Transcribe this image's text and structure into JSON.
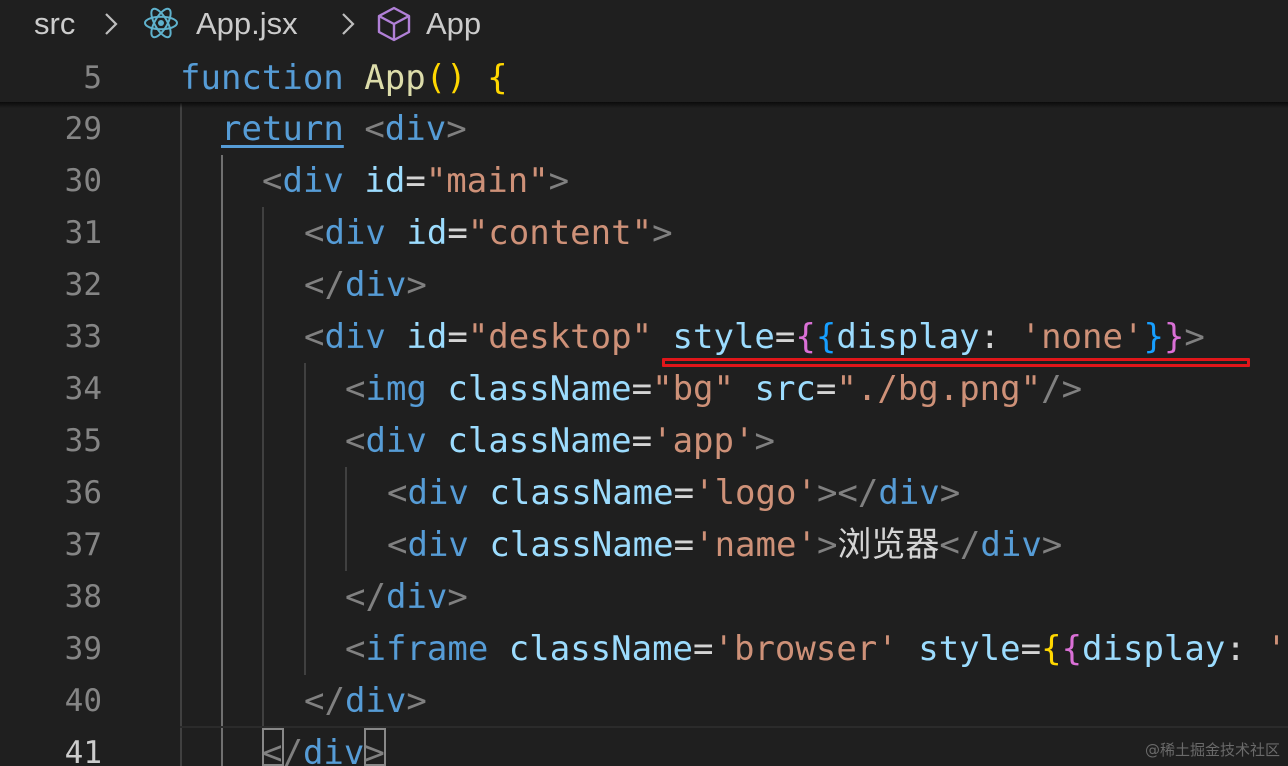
{
  "breadcrumb": {
    "folder": "src",
    "file": "App.jsx",
    "symbol": "App",
    "file_icon": "react-icon",
    "symbol_icon": "cube-icon"
  },
  "sticky_line": {
    "number": "5",
    "tokens": [
      {
        "t": "function",
        "c": "kw"
      },
      {
        "t": " ",
        "c": "txt"
      },
      {
        "t": "App",
        "c": "fn"
      },
      {
        "t": "()",
        "c": "br1"
      },
      {
        "t": " ",
        "c": "txt"
      },
      {
        "t": "{",
        "c": "br1"
      }
    ]
  },
  "lines": [
    {
      "number": "29",
      "tokens": [
        {
          "t": "return",
          "c": "ctrl"
        },
        {
          "t": " ",
          "c": "txt"
        },
        {
          "t": "<",
          "c": "tagb"
        },
        {
          "t": "div",
          "c": "tag"
        },
        {
          "t": ">",
          "c": "tagb"
        }
      ]
    },
    {
      "number": "30",
      "tokens": [
        {
          "t": "<",
          "c": "tagb"
        },
        {
          "t": "div",
          "c": "tag"
        },
        {
          "t": " ",
          "c": "txt"
        },
        {
          "t": "id",
          "c": "attr"
        },
        {
          "t": "=",
          "c": "txt"
        },
        {
          "t": "\"main\"",
          "c": "str"
        },
        {
          "t": ">",
          "c": "tagb"
        }
      ]
    },
    {
      "number": "31",
      "tokens": [
        {
          "t": "<",
          "c": "tagb"
        },
        {
          "t": "div",
          "c": "tag"
        },
        {
          "t": " ",
          "c": "txt"
        },
        {
          "t": "id",
          "c": "attr"
        },
        {
          "t": "=",
          "c": "txt"
        },
        {
          "t": "\"content\"",
          "c": "str"
        },
        {
          "t": ">",
          "c": "tagb"
        }
      ]
    },
    {
      "number": "32",
      "tokens": [
        {
          "t": "</",
          "c": "tagb"
        },
        {
          "t": "div",
          "c": "tag"
        },
        {
          "t": ">",
          "c": "tagb"
        }
      ]
    },
    {
      "number": "33",
      "tokens": [
        {
          "t": "<",
          "c": "tagb"
        },
        {
          "t": "div",
          "c": "tag"
        },
        {
          "t": " ",
          "c": "txt"
        },
        {
          "t": "id",
          "c": "attr"
        },
        {
          "t": "=",
          "c": "txt"
        },
        {
          "t": "\"desktop\"",
          "c": "str"
        },
        {
          "t": " ",
          "c": "txt"
        },
        {
          "t": "style",
          "c": "attr"
        },
        {
          "t": "=",
          "c": "txt"
        },
        {
          "t": "{",
          "c": "br2"
        },
        {
          "t": "{",
          "c": "br3"
        },
        {
          "t": "display",
          "c": "attr"
        },
        {
          "t": ": ",
          "c": "txt"
        },
        {
          "t": "'none'",
          "c": "str"
        },
        {
          "t": "}",
          "c": "br3"
        },
        {
          "t": "}",
          "c": "br2"
        },
        {
          "t": ">",
          "c": "tagb"
        }
      ]
    },
    {
      "number": "34",
      "tokens": [
        {
          "t": "<",
          "c": "tagb"
        },
        {
          "t": "img",
          "c": "tag"
        },
        {
          "t": " ",
          "c": "txt"
        },
        {
          "t": "className",
          "c": "attr"
        },
        {
          "t": "=",
          "c": "txt"
        },
        {
          "t": "\"bg\"",
          "c": "str"
        },
        {
          "t": " ",
          "c": "txt"
        },
        {
          "t": "src",
          "c": "attr"
        },
        {
          "t": "=",
          "c": "txt"
        },
        {
          "t": "\"./bg.png\"",
          "c": "str"
        },
        {
          "t": "/>",
          "c": "tagb"
        }
      ]
    },
    {
      "number": "35",
      "tokens": [
        {
          "t": "<",
          "c": "tagb"
        },
        {
          "t": "div",
          "c": "tag"
        },
        {
          "t": " ",
          "c": "txt"
        },
        {
          "t": "className",
          "c": "attr"
        },
        {
          "t": "=",
          "c": "txt"
        },
        {
          "t": "'app'",
          "c": "str"
        },
        {
          "t": ">",
          "c": "tagb"
        }
      ]
    },
    {
      "number": "36",
      "tokens": [
        {
          "t": "<",
          "c": "tagb"
        },
        {
          "t": "div",
          "c": "tag"
        },
        {
          "t": " ",
          "c": "txt"
        },
        {
          "t": "className",
          "c": "attr"
        },
        {
          "t": "=",
          "c": "txt"
        },
        {
          "t": "'logo'",
          "c": "str"
        },
        {
          "t": "></",
          "c": "tagb"
        },
        {
          "t": "div",
          "c": "tag"
        },
        {
          "t": ">",
          "c": "tagb"
        }
      ]
    },
    {
      "number": "37",
      "tokens": [
        {
          "t": "<",
          "c": "tagb"
        },
        {
          "t": "div",
          "c": "tag"
        },
        {
          "t": " ",
          "c": "txt"
        },
        {
          "t": "className",
          "c": "attr"
        },
        {
          "t": "=",
          "c": "txt"
        },
        {
          "t": "'name'",
          "c": "str"
        },
        {
          "t": ">",
          "c": "tagb"
        },
        {
          "t": "浏览器",
          "c": "txt"
        },
        {
          "t": "</",
          "c": "tagb"
        },
        {
          "t": "div",
          "c": "tag"
        },
        {
          "t": ">",
          "c": "tagb"
        }
      ]
    },
    {
      "number": "38",
      "tokens": [
        {
          "t": "</",
          "c": "tagb"
        },
        {
          "t": "div",
          "c": "tag"
        },
        {
          "t": ">",
          "c": "tagb"
        }
      ]
    },
    {
      "number": "39",
      "tokens": [
        {
          "t": "<",
          "c": "tagb"
        },
        {
          "t": "iframe",
          "c": "tag"
        },
        {
          "t": " ",
          "c": "txt"
        },
        {
          "t": "className",
          "c": "attr"
        },
        {
          "t": "=",
          "c": "txt"
        },
        {
          "t": "'browser'",
          "c": "str"
        },
        {
          "t": " ",
          "c": "txt"
        },
        {
          "t": "style",
          "c": "attr"
        },
        {
          "t": "=",
          "c": "txt"
        },
        {
          "t": "{",
          "c": "br1"
        },
        {
          "t": "{",
          "c": "br2"
        },
        {
          "t": "display",
          "c": "attr"
        },
        {
          "t": ": ",
          "c": "txt"
        },
        {
          "t": "'",
          "c": "str"
        }
      ]
    },
    {
      "number": "40",
      "tokens": [
        {
          "t": "</",
          "c": "tagb"
        },
        {
          "t": "div",
          "c": "tag"
        },
        {
          "t": ">",
          "c": "tagb"
        }
      ]
    },
    {
      "number": "41",
      "active": true,
      "tokens": [
        {
          "t": "</",
          "c": "tagb"
        },
        {
          "t": "div",
          "c": "tag"
        },
        {
          "t": ">",
          "c": "tagb"
        }
      ]
    }
  ],
  "watermark": "@稀土掘金技术社区",
  "colors": {
    "background": "#1f1f1f",
    "keyword": "#569cd6",
    "function": "#dcdcaa",
    "attribute": "#9cdcfe",
    "string": "#ce9178",
    "bracket_gold": "#ffd700",
    "bracket_orchid": "#da70d6",
    "bracket_blue": "#179fff",
    "annotation_red": "#e0161a"
  }
}
